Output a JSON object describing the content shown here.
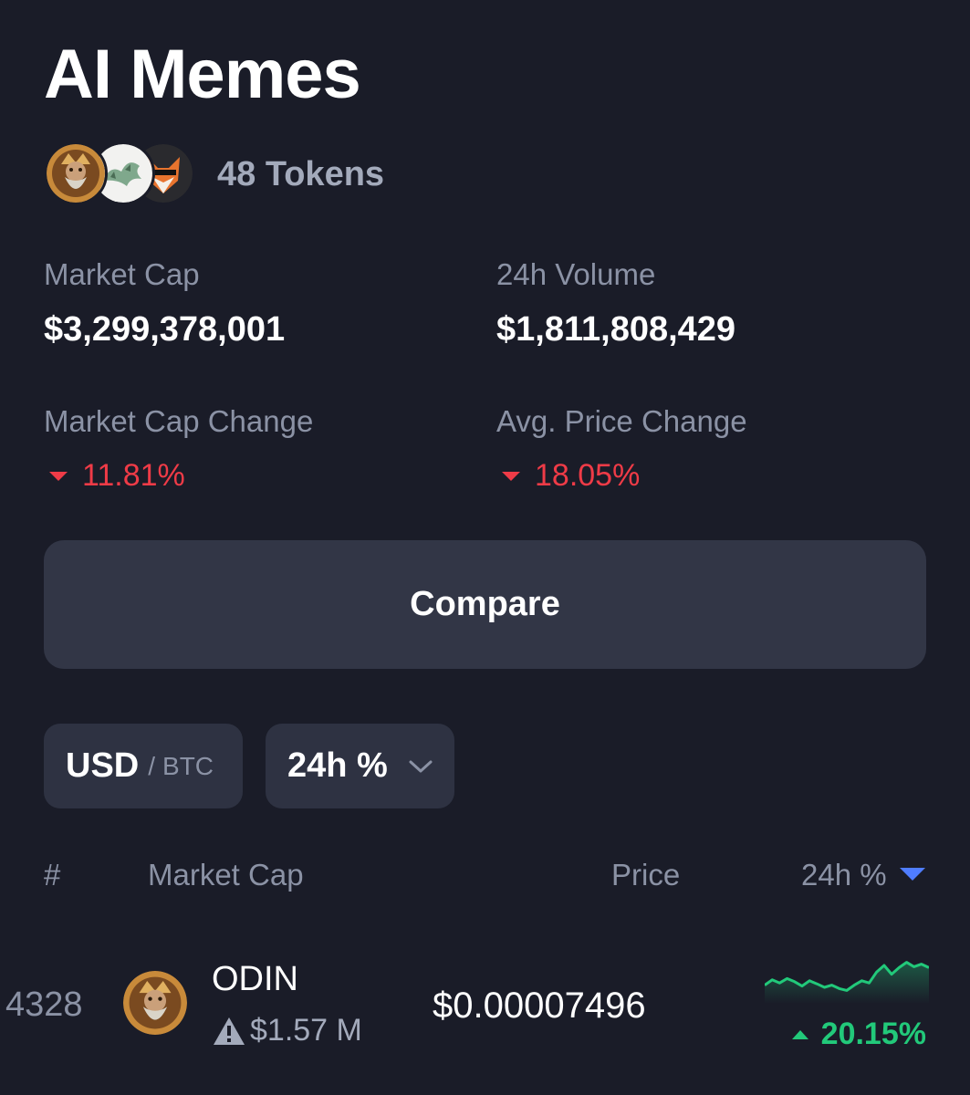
{
  "header": {
    "title": "AI Memes",
    "token_count": "48 Tokens",
    "avatars": [
      "odin-token-icon",
      "dragon-token-icon",
      "fox-token-icon"
    ]
  },
  "stats": {
    "market_cap_label": "Market Cap",
    "market_cap_value": "$3,299,378,001",
    "volume_label": "24h Volume",
    "volume_value": "$1,811,808,429",
    "market_cap_change_label": "Market Cap Change",
    "market_cap_change_value": "11.81%",
    "avg_price_change_label": "Avg. Price Change",
    "avg_price_change_value": "18.05%",
    "negative_color": "#ef3b47"
  },
  "compare_label": "Compare",
  "filters": {
    "currency_active": "USD",
    "currency_separator": "/",
    "currency_alt": "BTC",
    "period": "24h %"
  },
  "table": {
    "headers": {
      "rank": "#",
      "market_cap": "Market Cap",
      "price": "Price",
      "change": "24h %"
    },
    "rows": [
      {
        "rank": "4328",
        "name": "ODIN",
        "market_cap": "$1.57 M",
        "price": "$0.00007496",
        "change": "20.15%",
        "trend": "up",
        "sparkline": [
          0.3,
          0.42,
          0.35,
          0.45,
          0.38,
          0.28,
          0.4,
          0.33,
          0.25,
          0.3,
          0.22,
          0.18,
          0.3,
          0.4,
          0.35,
          0.6,
          0.75,
          0.55,
          0.7,
          0.82,
          0.72,
          0.78,
          0.7
        ]
      }
    ],
    "positive_color": "#22c97a",
    "sort_color": "#4f7dff"
  }
}
